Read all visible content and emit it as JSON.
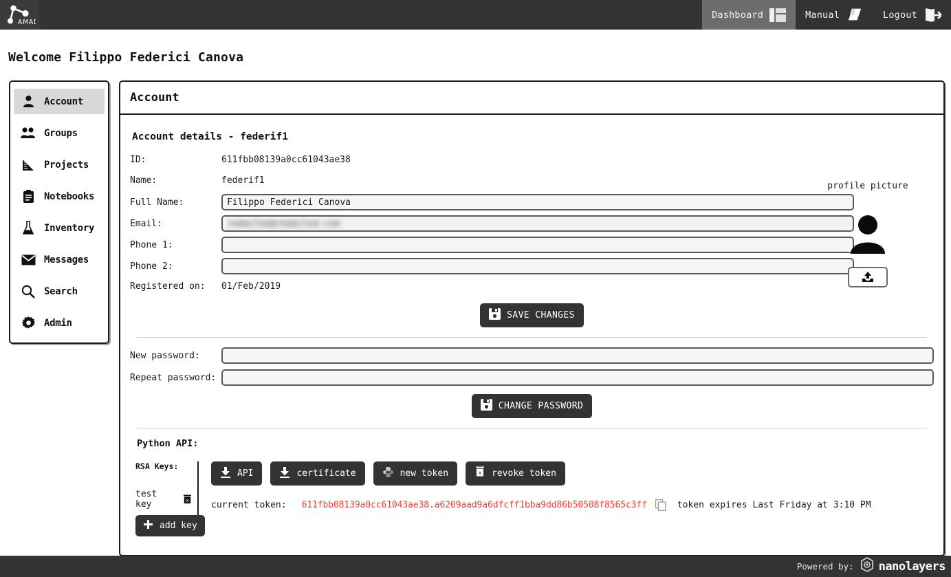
{
  "topbar": {
    "logo_text": "AMAD",
    "nav": [
      {
        "label": "Dashboard",
        "icon": "dashboard-icon",
        "active": true
      },
      {
        "label": "Manual",
        "icon": "book-icon",
        "active": false
      },
      {
        "label": "Logout",
        "icon": "logout-icon",
        "active": false
      }
    ]
  },
  "welcome": "Welcome Filippo Federici Canova",
  "sidebar": {
    "items": [
      {
        "label": "Account",
        "icon": "person-icon"
      },
      {
        "label": "Groups",
        "icon": "people-icon"
      },
      {
        "label": "Projects",
        "icon": "ruler-icon"
      },
      {
        "label": "Notebooks",
        "icon": "clipboard-icon"
      },
      {
        "label": "Inventory",
        "icon": "flask-icon"
      },
      {
        "label": "Messages",
        "icon": "envelope-icon"
      },
      {
        "label": "Search",
        "icon": "magnifier-icon"
      },
      {
        "label": "Admin",
        "icon": "gear-icon"
      }
    ]
  },
  "panel": {
    "title": "Account",
    "section_title": "Account details - federif1",
    "fields": {
      "id_label": "ID:",
      "id_value": "611fbb08139a0cc61043ae38",
      "name_label": "Name:",
      "name_value": "federif1",
      "fullname_label": "Full Name:",
      "fullname_value": "Filippo Federici Canova",
      "email_label": "Email:",
      "email_value": "redacted@redacted.com",
      "phone1_label": "Phone 1:",
      "phone1_value": "",
      "phone2_label": "Phone 2:",
      "phone2_value": "",
      "registered_label": "Registered on:",
      "registered_value": "01/Feb/2019"
    },
    "profile": {
      "caption": "profile picture",
      "avatar_icon": "person-avatar-icon",
      "upload_icon": "upload-icon"
    },
    "save_changes": {
      "label": "Save Changes",
      "icon": "save-icon"
    },
    "password": {
      "new_label": "New password:",
      "new_value": "",
      "repeat_label": "Repeat password:",
      "repeat_value": "",
      "change_button": {
        "label": "Change Password",
        "icon": "save-icon"
      }
    },
    "api": {
      "title": "Python API:",
      "rsa_title": "RSA Keys:",
      "keys": [
        {
          "name": "test key",
          "delete_icon": "delete-icon"
        }
      ],
      "add_key": {
        "label": "add key",
        "icon": "plus-icon"
      },
      "buttons": [
        {
          "label": "API",
          "icon": "download-icon"
        },
        {
          "label": "certificate",
          "icon": "download-icon"
        },
        {
          "label": "new token",
          "icon": "python-icon"
        },
        {
          "label": "revoke token",
          "icon": "trash-icon"
        }
      ],
      "token_label": "current token:",
      "token_value": "611fbb08139a0cc61043ae38.a6209aad9a6dfcff1bba9dd86b50508f8565c3ff",
      "copy_icon": "copy-icon",
      "token_expiry": "token expires Last Friday at 3:10 PM"
    }
  },
  "footer": {
    "powered_by": "Powered by:",
    "brand": "nanolayers",
    "brand_icon": "hexagon-logo-icon"
  },
  "colors": {
    "topbar_bg": "#333333",
    "active_nav_bg": "#6d6d6d",
    "sidebar_active_bg": "#d8d8d8",
    "button_bg": "#333333",
    "token_red": "#ff3b30",
    "border_dark": "#1b1b1b",
    "input_bg": "#f6f6f6"
  }
}
